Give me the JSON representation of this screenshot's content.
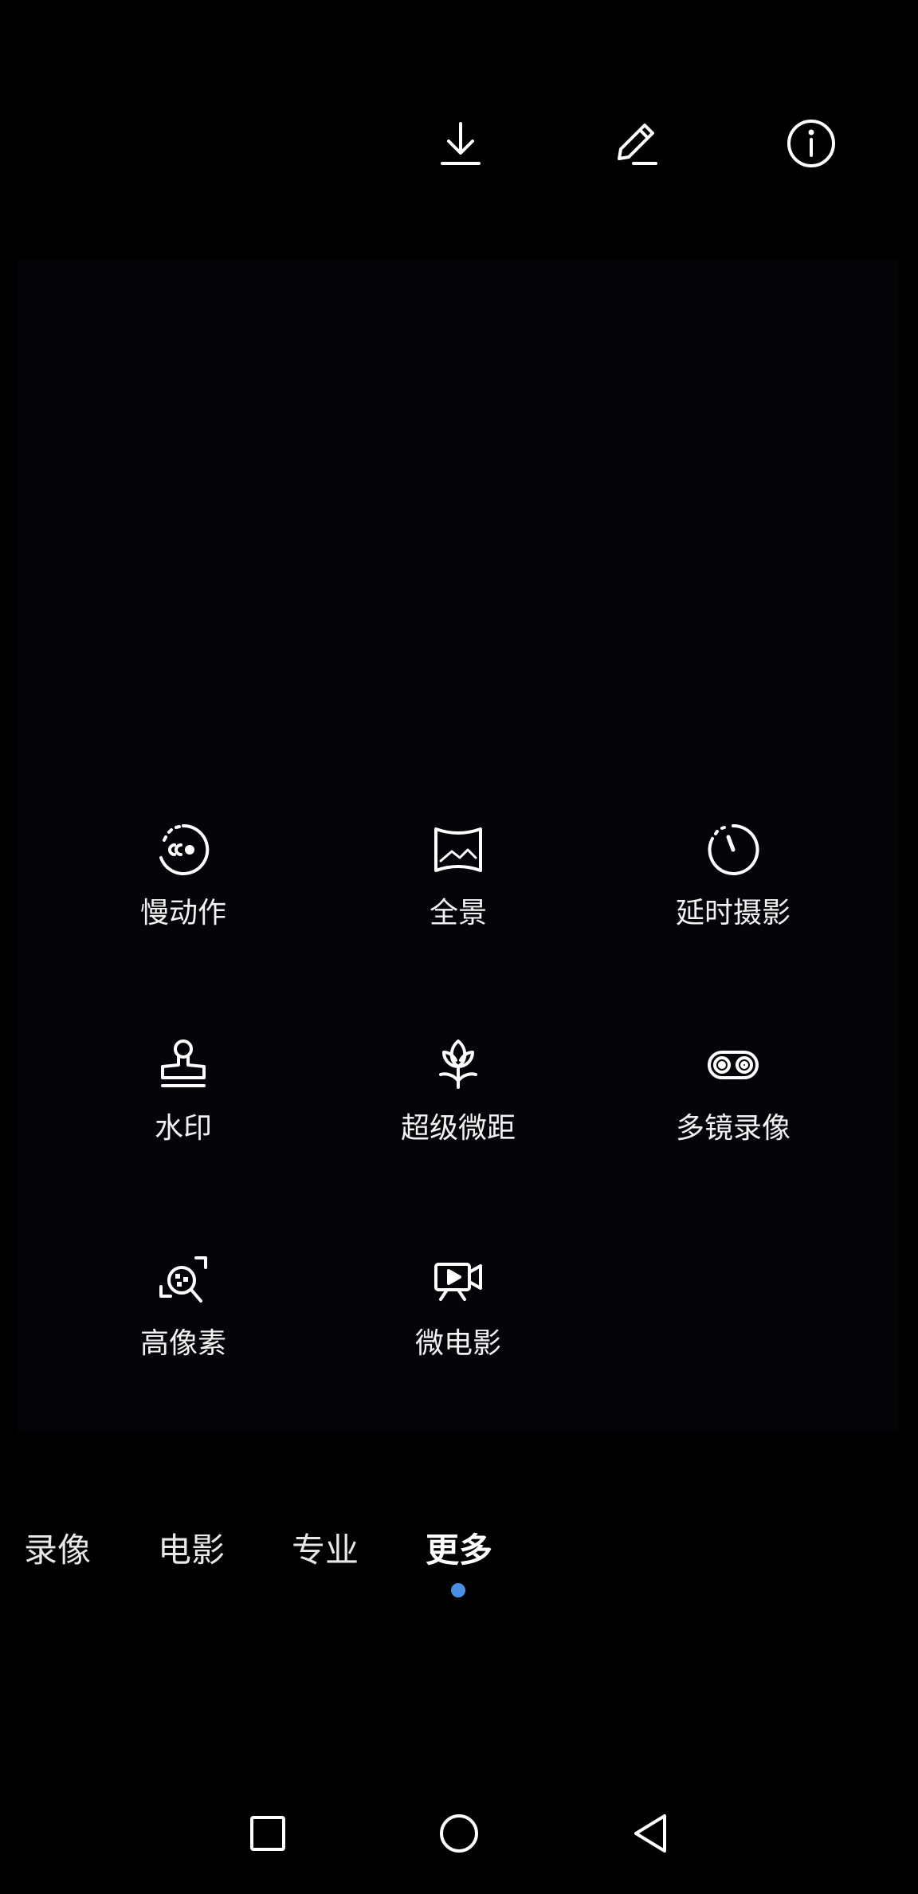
{
  "colors": {
    "accent": "#4a90e2",
    "icon": "#ffffff",
    "panel": "#050408",
    "background": "#000000"
  },
  "top_bar": {
    "icons": [
      "download-icon",
      "edit-icon",
      "info-icon"
    ]
  },
  "modes": [
    {
      "label": "慢动作",
      "icon": "slow-motion-icon"
    },
    {
      "label": "全景",
      "icon": "panorama-icon"
    },
    {
      "label": "延时摄影",
      "icon": "time-lapse-icon"
    },
    {
      "label": "水印",
      "icon": "watermark-stamp-icon"
    },
    {
      "label": "超级微距",
      "icon": "super-macro-flower-icon"
    },
    {
      "label": "多镜录像",
      "icon": "multi-lens-video-icon"
    },
    {
      "label": "高像素",
      "icon": "high-resolution-icon"
    },
    {
      "label": "微电影",
      "icon": "micro-movie-icon"
    }
  ],
  "mode_tabs": [
    {
      "label": "录像",
      "active": false
    },
    {
      "label": "电影",
      "active": false
    },
    {
      "label": "专业",
      "active": false
    },
    {
      "label": "更多",
      "active": true
    }
  ],
  "nav_bar": {
    "icons": [
      "recent-apps-square-icon",
      "home-circle-icon",
      "back-triangle-icon"
    ]
  }
}
